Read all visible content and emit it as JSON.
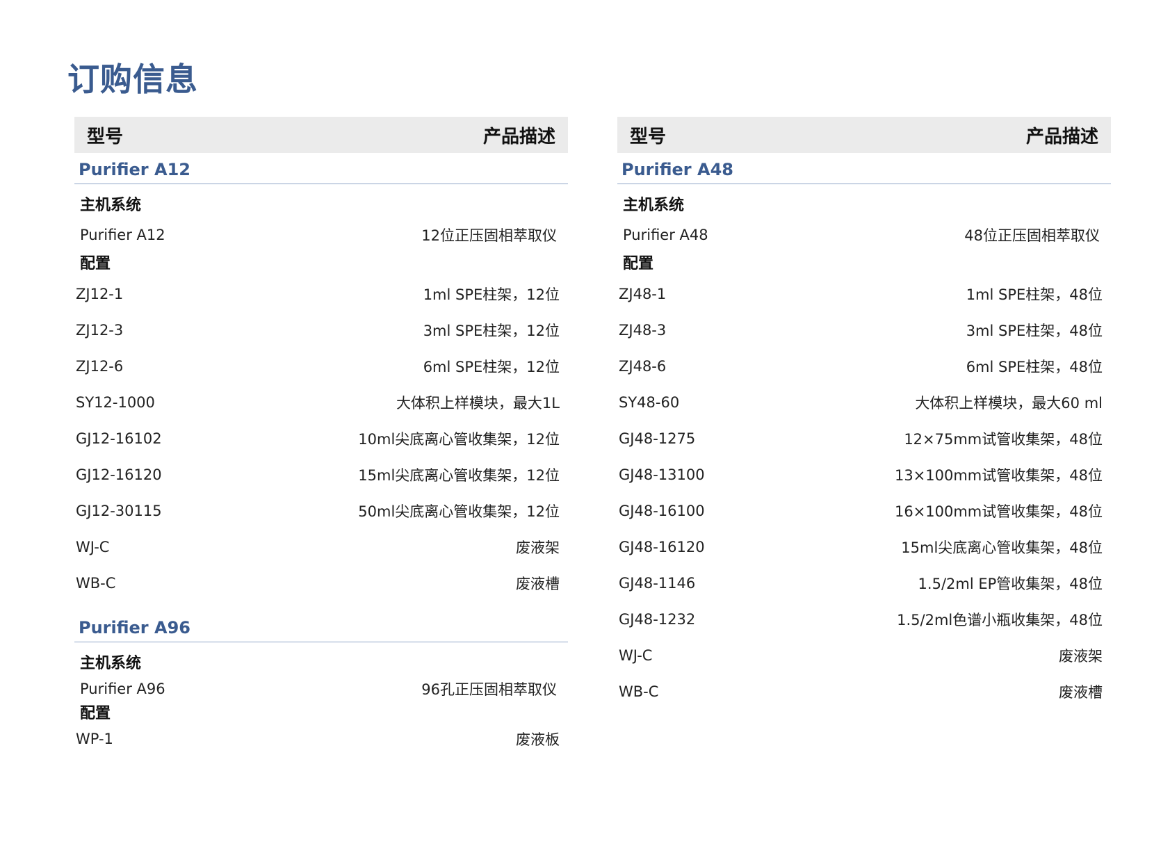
{
  "title": "订购信息",
  "table_header": {
    "model": "型号",
    "description": "产品描述"
  },
  "left": {
    "sections": [
      {
        "name": "Purifier A12",
        "host_label": "主机系统",
        "host": {
          "model": "Purifier A12",
          "desc": "12位正压固相萃取仪"
        },
        "config_label": "配置",
        "items": [
          {
            "model": "ZJ12-1",
            "desc": "1ml SPE柱架，12位"
          },
          {
            "model": "ZJ12-3",
            "desc": "3ml SPE柱架，12位"
          },
          {
            "model": "ZJ12-6",
            "desc": "6ml SPE柱架，12位"
          },
          {
            "model": "SY12-1000",
            "desc": "大体积上样模块，最大1L"
          },
          {
            "model": "GJ12-16102",
            "desc": "10ml尖底离心管收集架，12位"
          },
          {
            "model": "GJ12-16120",
            "desc": "15ml尖底离心管收集架，12位"
          },
          {
            "model": "GJ12-30115",
            "desc": "50ml尖底离心管收集架，12位"
          },
          {
            "model": "WJ-C",
            "desc": "废液架"
          },
          {
            "model": "WB-C",
            "desc": "废液槽"
          }
        ]
      },
      {
        "name": "Purifier A96",
        "host_label": "主机系统",
        "host": {
          "model": "Purifier A96",
          "desc": "96孔正压固相萃取仪"
        },
        "config_label": "配置",
        "items": [
          {
            "model": "WP-1",
            "desc": "废液板"
          }
        ]
      }
    ]
  },
  "right": {
    "sections": [
      {
        "name": "Purifier A48",
        "host_label": "主机系统",
        "host": {
          "model": "Purifier A48",
          "desc": "48位正压固相萃取仪"
        },
        "config_label": "配置",
        "items": [
          {
            "model": "ZJ48-1",
            "desc": "1ml SPE柱架，48位"
          },
          {
            "model": "ZJ48-3",
            "desc": "3ml SPE柱架，48位"
          },
          {
            "model": "ZJ48-6",
            "desc": "6ml SPE柱架，48位"
          },
          {
            "model": "SY48-60",
            "desc": "大体积上样模块，最大60 ml"
          },
          {
            "model": "GJ48-1275",
            "desc": "12×75mm试管收集架，48位"
          },
          {
            "model": "GJ48-13100",
            "desc": "13×100mm试管收集架，48位"
          },
          {
            "model": "GJ48-16100",
            "desc": "16×100mm试管收集架，48位"
          },
          {
            "model": "GJ48-16120",
            "desc": "15ml尖底离心管收集架，48位"
          },
          {
            "model": "GJ48-1146",
            "desc": "1.5/2ml EP管收集架，48位"
          },
          {
            "model": "GJ48-1232",
            "desc": "1.5/2ml色谱小瓶收集架，48位"
          },
          {
            "model": "WJ-C",
            "desc": "废液架"
          },
          {
            "model": "WB-C",
            "desc": "废液槽"
          }
        ]
      }
    ]
  }
}
